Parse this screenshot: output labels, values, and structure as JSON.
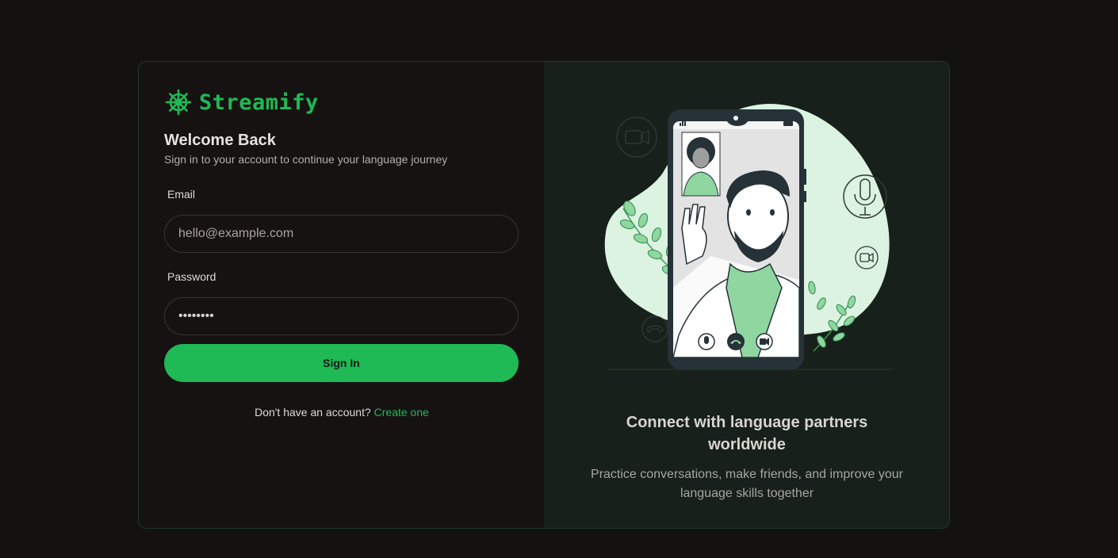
{
  "brand": {
    "name": "Streamify",
    "icon": "ship-wheel-icon",
    "color": "#1fb955"
  },
  "login": {
    "title": "Welcome Back",
    "subtitle": "Sign in to your account to continue your language journey",
    "email_label": "Email",
    "email_placeholder": "hello@example.com",
    "email_value": "",
    "password_label": "Password",
    "password_value": "••••••••",
    "submit_label": "Sign In",
    "signup_prompt": "Don't have an account?",
    "signup_link": "Create one"
  },
  "promo": {
    "title": "Connect with language partners worldwide",
    "text": "Practice conversations, make friends, and improve your language skills together",
    "illustration": "video-call-illustration"
  },
  "colors": {
    "accent": "#1fb955",
    "background": "#141111",
    "panel_left": "#161212",
    "panel_right": "#17201a"
  }
}
